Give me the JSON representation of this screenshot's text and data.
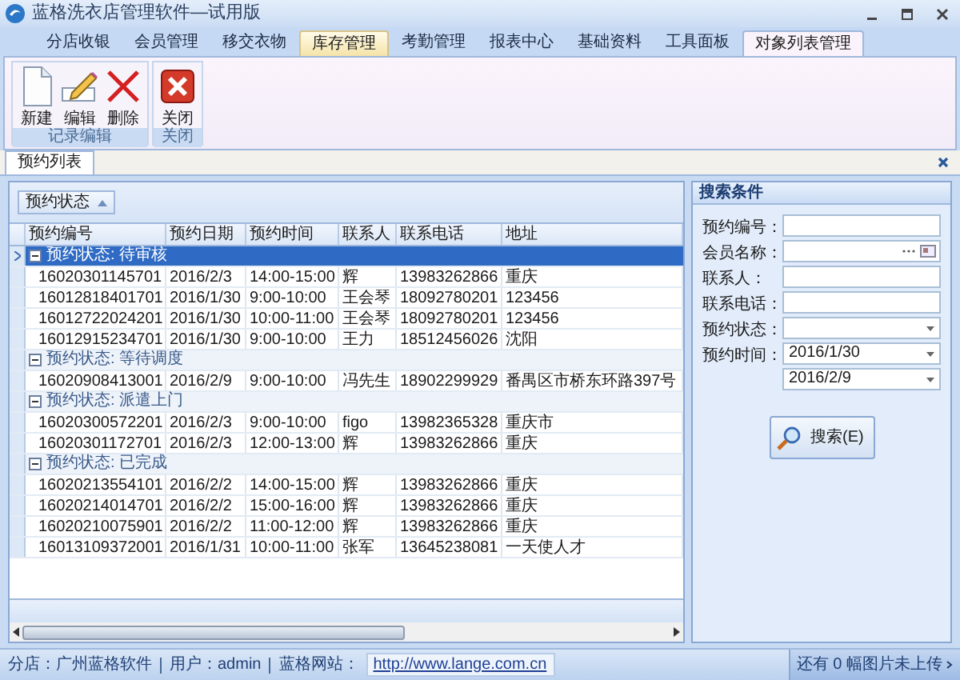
{
  "window": {
    "title": "蓝格洗衣店管理软件—试用版"
  },
  "menu_tabs": [
    {
      "label": "分店收银",
      "selected": false,
      "hovered": false
    },
    {
      "label": "会员管理",
      "selected": false,
      "hovered": false
    },
    {
      "label": "移交衣物",
      "selected": false,
      "hovered": false
    },
    {
      "label": "库存管理",
      "selected": false,
      "hovered": true
    },
    {
      "label": "考勤管理",
      "selected": false,
      "hovered": false
    },
    {
      "label": "报表中心",
      "selected": false,
      "hovered": false
    },
    {
      "label": "基础资料",
      "selected": false,
      "hovered": false
    },
    {
      "label": "工具面板",
      "selected": false,
      "hovered": false
    },
    {
      "label": "对象列表管理",
      "selected": true,
      "hovered": false
    }
  ],
  "ribbon": {
    "groups": [
      {
        "label": "记录编辑",
        "buttons": [
          {
            "label": "新建",
            "kind": "new"
          },
          {
            "label": "编辑",
            "kind": "edit"
          },
          {
            "label": "删除",
            "kind": "delete"
          }
        ]
      },
      {
        "label": "关闭",
        "buttons": [
          {
            "label": "关闭",
            "kind": "close"
          }
        ]
      }
    ]
  },
  "document_tabs": [
    {
      "label": "预约列表",
      "selected": true
    }
  ],
  "grid": {
    "group_by": "预约状态",
    "columns": [
      "预约编号",
      "预约日期",
      "预约时间",
      "联系人",
      "联系电话",
      "地址"
    ],
    "groups": [
      {
        "label": "预约状态: 待审核",
        "selected": true,
        "expanded": true,
        "rows": [
          [
            "16020301145701",
            "2016/2/3",
            "14:00-15:00",
            "辉",
            "13983262866",
            "重庆"
          ],
          [
            "16012818401701",
            "2016/1/30",
            "9:00-10:00",
            "王会琴",
            "18092780201",
            "123456"
          ],
          [
            "16012722024201",
            "2016/1/30",
            "10:00-11:00",
            "王会琴",
            "18092780201",
            "123456"
          ],
          [
            "16012915234701",
            "2016/1/30",
            "9:00-10:00",
            "王力",
            "18512456026",
            "沈阳"
          ]
        ]
      },
      {
        "label": "预约状态: 等待调度",
        "selected": false,
        "expanded": true,
        "rows": [
          [
            "16020908413001",
            "2016/2/9",
            "9:00-10:00",
            "冯先生",
            "18902299929",
            "番禺区市桥东环路397号"
          ]
        ]
      },
      {
        "label": "预约状态: 派遣上门",
        "selected": false,
        "expanded": true,
        "rows": [
          [
            "16020300572201",
            "2016/2/3",
            "9:00-10:00",
            "figo",
            "13982365328",
            "重庆市"
          ],
          [
            "16020301172701",
            "2016/2/3",
            "12:00-13:00",
            "辉",
            "13983262866",
            "重庆"
          ]
        ]
      },
      {
        "label": "预约状态: 已完成",
        "selected": false,
        "expanded": true,
        "rows": [
          [
            "16020213554101",
            "2016/2/2",
            "14:00-15:00",
            "辉",
            "13983262866",
            "重庆"
          ],
          [
            "16020214014701",
            "2016/2/2",
            "15:00-16:00",
            "辉",
            "13983262866",
            "重庆"
          ],
          [
            "16020210075901",
            "2016/2/2",
            "11:00-12:00",
            "辉",
            "13983262866",
            "重庆"
          ],
          [
            "16013109372001",
            "2016/1/31",
            "10:00-11:00",
            "张军",
            "13645238081",
            "一天使人才"
          ]
        ]
      }
    ]
  },
  "search_panel": {
    "title": "搜索条件",
    "fields": [
      {
        "label": "预约编号：",
        "kind": "text"
      },
      {
        "label": "会员名称：",
        "kind": "lookup"
      },
      {
        "label": "联系人：",
        "kind": "text"
      },
      {
        "label": "联系电话：",
        "kind": "text"
      },
      {
        "label": "预约状态：",
        "kind": "dropdown"
      },
      {
        "label": "预约时间：",
        "kind": "dropdown",
        "value": "2016/1/30"
      },
      {
        "kind": "dropdown",
        "value": "2016/2/9"
      }
    ],
    "button": "搜索(E)"
  },
  "status_bar": {
    "items": [
      "分店：广州蓝格软件",
      "用户：admin",
      "蓝格网站："
    ],
    "url": "http://www.lange.com.cn",
    "upload_notice": "还有 0 幅图片未上传"
  }
}
